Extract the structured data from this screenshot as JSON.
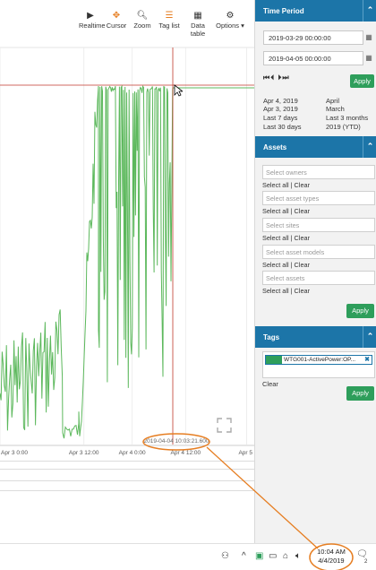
{
  "toolbar": {
    "realtime": "Realtime",
    "cursor": "Cursor",
    "zoom": "Zoom",
    "tag_list": "Tag list",
    "data_table": "Data table",
    "options": "Options ▾"
  },
  "chart": {
    "cursor_timestamp": "2019-04-04 10:03:21.600",
    "x_ticks": [
      "Apr 3 0:00",
      "Apr 3 12:00",
      "Apr 4 0:00",
      "Apr 4 12:00",
      "Apr 5"
    ],
    "x_tick_fracs": [
      0.0,
      0.33,
      0.52,
      0.73,
      0.97
    ],
    "series_color": "#5cb85c",
    "cursor_color": "#c0392b"
  },
  "sidebar": {
    "time_period": {
      "title": "Time Period",
      "start": "2019-03-29 00:00:00",
      "end": "2019-04-05 00:00:00",
      "nav": "⏮⏴  ⏵⏭",
      "apply": "Apply",
      "quick_left": [
        "Apr 4, 2019",
        "Apr 3, 2019",
        "Last 7 days",
        "Last 30 days"
      ],
      "quick_right": [
        "April",
        "March",
        "Last 3 months",
        "2019 (YTD)"
      ]
    },
    "assets": {
      "title": "Assets",
      "filters": [
        {
          "placeholder": "Select owners",
          "links": "Select all | Clear"
        },
        {
          "placeholder": "Select asset types",
          "links": "Select all | Clear"
        },
        {
          "placeholder": "Select sites",
          "links": "Select all | Clear"
        },
        {
          "placeholder": "Select asset models",
          "links": "Select all | Clear"
        },
        {
          "placeholder": "Select assets",
          "links": "Select all | Clear"
        }
      ],
      "apply": "Apply"
    },
    "tags": {
      "title": "Tags",
      "chip": "WTG001-ActivePower:OP...",
      "clear": "Clear",
      "apply": "Apply"
    }
  },
  "taskbar": {
    "time": "10:04 AM",
    "date": "4/4/2019",
    "notif_count": "2"
  }
}
